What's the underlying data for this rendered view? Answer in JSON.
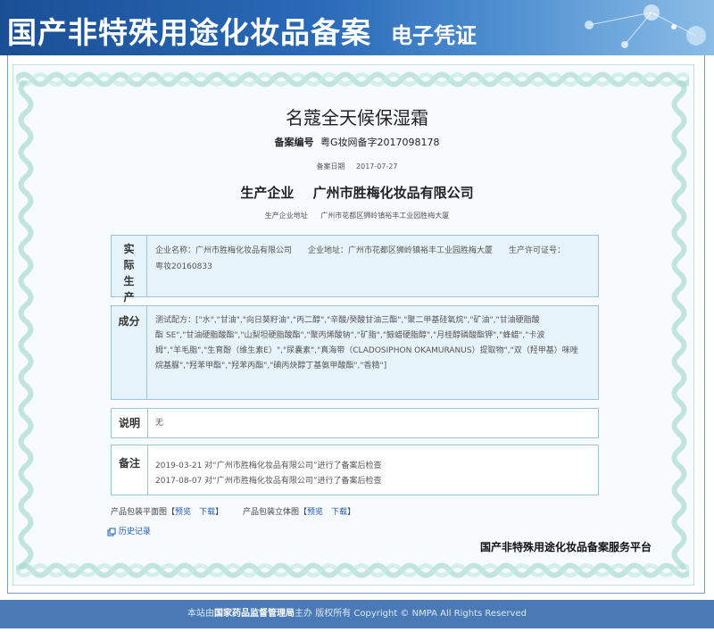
{
  "header": {
    "title": "国产非特殊用途化妆品备案",
    "subtitle": "电子凭证"
  },
  "product": {
    "name": "名蔻全天候保湿霜",
    "record_label": "备案编号",
    "record_number": "粤G妆网备字2017098178",
    "date_label": "备案日期",
    "date": "2017-07-27",
    "producer_label": "生产企业",
    "producer": "广州市胜梅化妆品有限公司",
    "address_label": "生产企业地址",
    "address": "广州市花都区狮岭镇裕丰工业园胜梅大厦"
  },
  "actual_enterprise": {
    "label": "实际生产企业",
    "line1": "企业名称：广州市胜梅化妆品有限公司　　企业地址：广州市花都区狮岭镇裕丰工业园胜梅大厦　　生产许可证号：",
    "line2": "粤妆20160833"
  },
  "ingredients": {
    "label": "成分",
    "lines": [
      "测试配方：[\"水\",\"甘油\",\"向日葵籽油\",\"丙二醇\",\"辛酸/癸酸甘油三酯\",\"聚二甲基硅氧烷\",\"矿油\",\"甘油硬脂酸",
      "酯 SE\",\"甘油硬脂酸酯\",\"山梨坦硬脂酸酯\",\"聚丙烯酸钠\",\"矿脂\",\"鲸蜡硬脂醇\",\"月桂醇磷酸酯钾\",\"蜂蜡\",\"卡波",
      "姆\",\"羊毛脂\",\"生育酚（维生素E）\",\"尿囊素\",\"真海带（CLADOSIPHON OKAMURANUS）提取物\",\"双（羟甲基）咪唑",
      "烷基脲\",\"羟苯甲酯\",\"羟苯丙酯\",\"碘丙炔醇丁基氨甲酸酯\",\"香精\"]"
    ]
  },
  "note": {
    "label": "说明",
    "value": "无"
  },
  "history": {
    "label": "备注",
    "rows": [
      "2019-03-21 对“广州市胜梅化妆品有限公司”进行了备案后检查",
      "2017-08-07 对“广州市胜梅化妆品有限公司”进行了备案后检查"
    ]
  },
  "images": {
    "flat_label": "产品包装平面图",
    "box_label": "产品包装立体图",
    "preview": "预览",
    "download": "下载",
    "history_link": "历史记录"
  },
  "platform": "国产非特殊用途化妆品备案服务平台",
  "footer": {
    "prefix": "本站由",
    "org": "国家药品监督管理局",
    "suffix": "主办 版权所有 Copyright © NMPA All Rights Reserved"
  },
  "colors": {
    "header_blue": "#1a4f95",
    "box_fill": "#e7f3fb",
    "link_blue": "#1a5bb5",
    "footer_blue": "#4a7ab6"
  }
}
